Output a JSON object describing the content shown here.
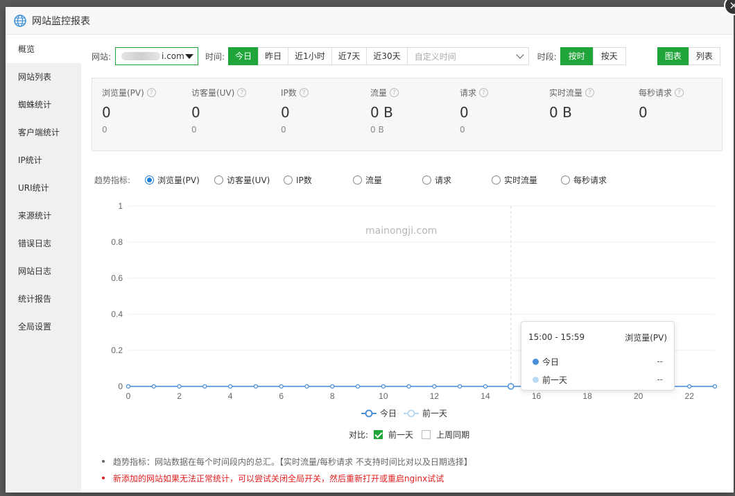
{
  "dialog": {
    "title": "网站监控报表",
    "close_label": "×"
  },
  "sidebar": {
    "items": [
      {
        "label": "概览",
        "active": true
      },
      {
        "label": "网站列表"
      },
      {
        "label": "蜘蛛统计"
      },
      {
        "label": "客户端统计"
      },
      {
        "label": "IP统计"
      },
      {
        "label": "URI统计"
      },
      {
        "label": "来源统计"
      },
      {
        "label": "错误日志"
      },
      {
        "label": "网站日志"
      },
      {
        "label": "统计报告"
      },
      {
        "label": "全局设置"
      }
    ]
  },
  "toolbar": {
    "site_label": "网站:",
    "site_value": "i.com",
    "time_label": "时间:",
    "time_buttons": [
      "今日",
      "昨日",
      "近1小时",
      "近7天",
      "近30天"
    ],
    "time_selected": "今日",
    "custom_time_placeholder": "自定义时间",
    "period_label": "时段:",
    "period_buttons": [
      "按时",
      "按天"
    ],
    "period_selected": "按时",
    "view_buttons": [
      "图表",
      "列表"
    ],
    "view_selected": "图表"
  },
  "stats": [
    {
      "name": "浏览量(PV)",
      "value": "0",
      "prev": "0"
    },
    {
      "name": "访客量(UV)",
      "value": "0",
      "prev": "0"
    },
    {
      "name": "IP数",
      "value": "0",
      "prev": "0"
    },
    {
      "name": "流量",
      "value": "0 B",
      "prev": "0 B"
    },
    {
      "name": "请求",
      "value": "0",
      "prev": "0"
    },
    {
      "name": "实时流量",
      "value": "0 B",
      "prev": ""
    },
    {
      "name": "每秒请求",
      "value": "0",
      "prev": ""
    }
  ],
  "trend": {
    "label": "趋势指标:",
    "options": [
      "浏览量(PV)",
      "访客量(UV)",
      "IP数",
      "流量",
      "请求",
      "实时流量",
      "每秒请求"
    ],
    "selected": "浏览量(PV)"
  },
  "watermark": "mainongji.com",
  "chart_data": {
    "type": "line",
    "x": [
      0,
      1,
      2,
      3,
      4,
      5,
      6,
      7,
      8,
      9,
      10,
      11,
      12,
      13,
      14,
      15,
      16,
      17,
      18,
      19,
      20,
      21,
      22,
      23
    ],
    "xticks": [
      0,
      2,
      4,
      6,
      8,
      10,
      12,
      14,
      16,
      18,
      20,
      22
    ],
    "yticks": [
      0,
      0.2,
      0.4,
      0.6,
      0.8,
      1
    ],
    "ylim": [
      0,
      1
    ],
    "series": [
      {
        "name": "今日",
        "color": "#4a8fd9",
        "values": [
          0,
          0,
          0,
          0,
          0,
          0,
          0,
          0,
          0,
          0,
          0,
          0,
          0,
          0,
          0,
          0,
          0,
          0,
          0,
          0,
          0,
          0,
          0,
          0
        ]
      },
      {
        "name": "前一天",
        "color": "#b8daf3",
        "values": [
          0,
          0,
          0,
          0,
          0,
          0,
          0,
          0,
          0,
          0,
          0,
          0,
          0,
          0,
          0,
          0,
          0,
          0,
          0,
          0,
          0,
          0,
          0,
          0
        ]
      }
    ],
    "highlight_x": 15,
    "grid": true,
    "legend": "bottom"
  },
  "tooltip": {
    "range": "15:00 - 15:59",
    "metric": "浏览量(PV)",
    "rows": [
      {
        "name": "今日",
        "color": "#4a8fd9",
        "value": "--"
      },
      {
        "name": "前一天",
        "color": "#b8daf3",
        "value": "--"
      }
    ]
  },
  "compare": {
    "label": "对比:",
    "options": [
      {
        "label": "前一天",
        "checked": true
      },
      {
        "label": "上周同期",
        "checked": false
      }
    ]
  },
  "notes": [
    {
      "text": "趋势指标：网站数据在每个时间段内的总汇。【实时流量/每秒请求 不支持时间比对以及日期选择】",
      "color": "#666666"
    },
    {
      "text": "新添加的网站如果无法正常统计，可以尝试关闭全局开关，然后重新打开或重启nginx试试",
      "color": "#e02020"
    }
  ]
}
